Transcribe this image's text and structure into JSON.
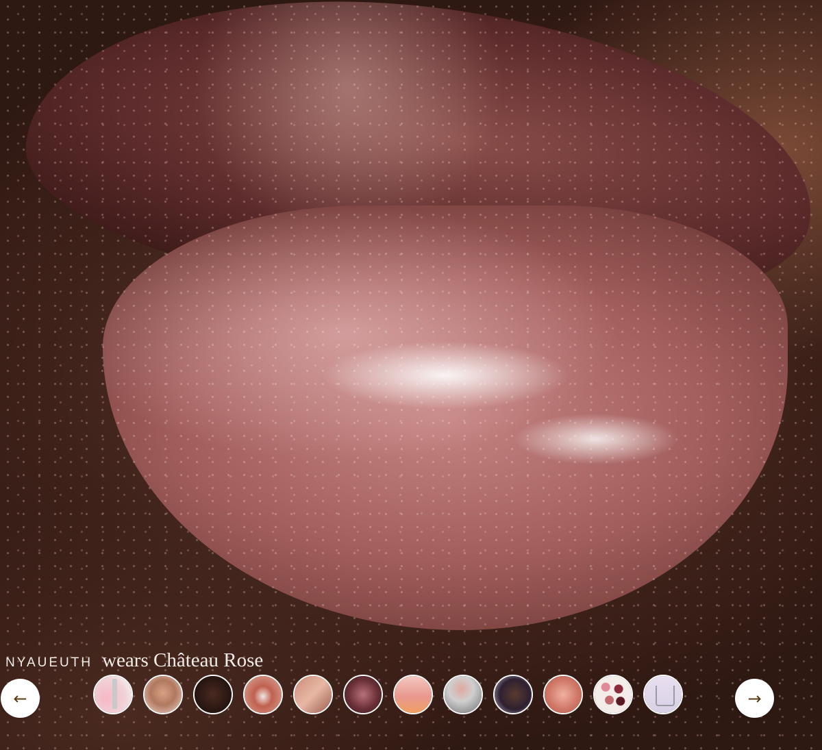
{
  "caption": {
    "name": "NYAUEUTH",
    "wears_prefix": "wears",
    "shade": "Château Rose"
  },
  "nav": {
    "prev_icon": "arrow-left-icon",
    "prev_glyph": "←",
    "next_icon": "arrow-right-icon",
    "next_glyph": "→"
  },
  "thumbnails": [
    {
      "name": "thumb-1",
      "desc": "product tube with pink swatch"
    },
    {
      "name": "thumb-2",
      "desc": "woman portrait"
    },
    {
      "name": "thumb-3",
      "desc": "dark portrait"
    },
    {
      "name": "thumb-4",
      "desc": "lips closeup"
    },
    {
      "name": "thumb-5",
      "desc": "face collage"
    },
    {
      "name": "thumb-6",
      "desc": "glitter lips"
    },
    {
      "name": "thumb-7",
      "desc": "gloss lips"
    },
    {
      "name": "thumb-8",
      "desc": "product applicator"
    },
    {
      "name": "thumb-9",
      "desc": "portrait with text"
    },
    {
      "name": "thumb-10",
      "desc": "lips gloss swatch"
    },
    {
      "name": "thumb-11",
      "desc": "color swatches"
    },
    {
      "name": "thumb-12",
      "desc": "product packaging"
    }
  ],
  "colors": {
    "caption_text": "#f2ece6",
    "nav_button_bg": "#ffffff",
    "nav_arrow": "#5a3a10"
  }
}
